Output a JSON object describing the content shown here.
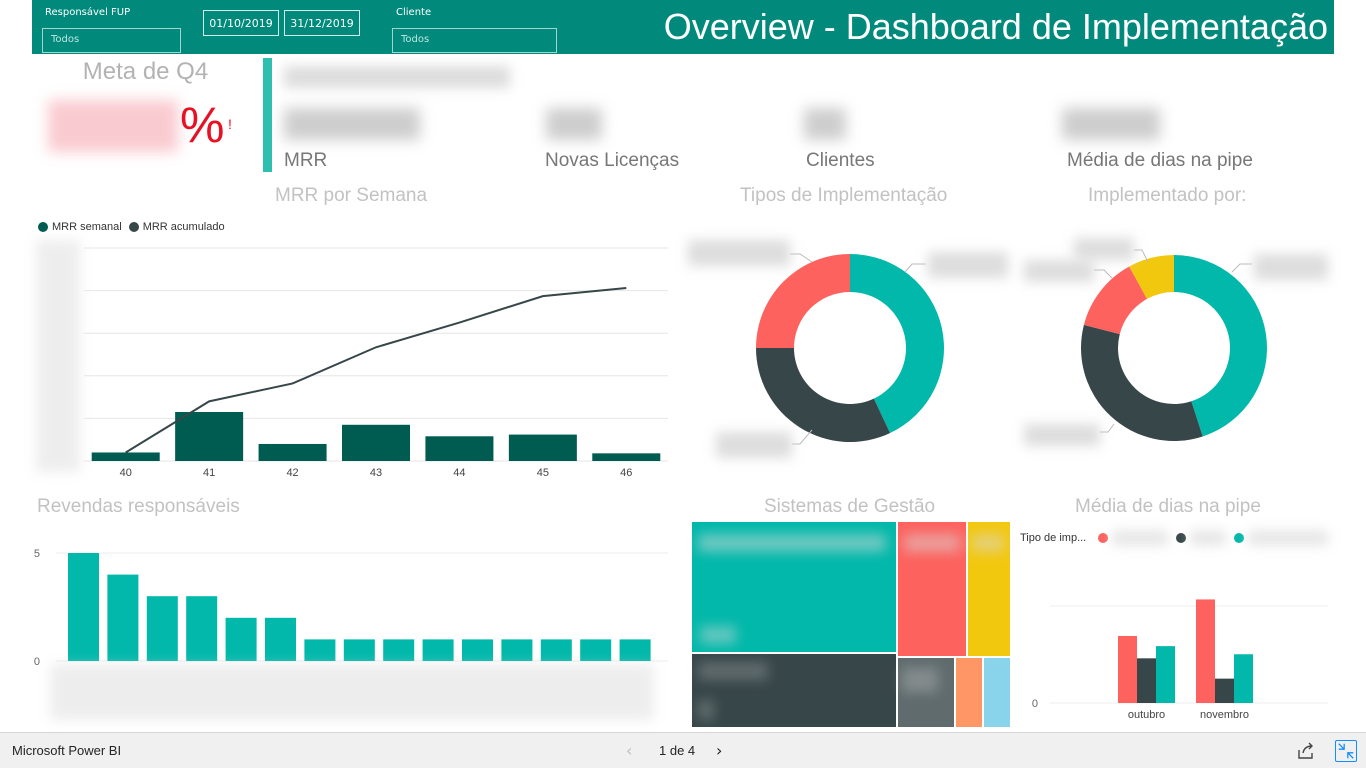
{
  "header": {
    "title": "Overview - Dashboard de Implementação",
    "filters": {
      "responsavel_label": "Responsável FUP",
      "responsavel_value": "Todos",
      "date_start": "01/10/2019",
      "date_end": "31/12/2019",
      "cliente_label": "Cliente",
      "cliente_value": "Todos"
    }
  },
  "kpis": {
    "meta_title": "Meta de Q4",
    "meta_symbol": "%",
    "meta_exclamation": "!",
    "labels": [
      "MRR",
      "Novas Licenças",
      "Clientes",
      "Média de dias na pipe"
    ]
  },
  "visual_titles": {
    "mrr_week": "MRR por Semana",
    "tipos": "Tipos de Implementação",
    "implementado": "Implementado por:",
    "revendas": "Revendas responsáveis",
    "sistemas": "Sistemas de Gestão",
    "media_dias": "Média de dias na pipe"
  },
  "colors": {
    "teal": "#01b8aa",
    "dark_gray": "#374649",
    "red": "#fd625e",
    "yellow": "#f2c80f",
    "gray": "#5f6b6d",
    "orange": "#fe9666",
    "light_blue": "#8ad4eb",
    "dark_teal": "#005b50",
    "header_bg": "#018a7c"
  },
  "chart_data": [
    {
      "type": "bar",
      "name": "mrr_week",
      "categories": [
        "40",
        "41",
        "42",
        "43",
        "44",
        "45",
        "46"
      ],
      "legend": [
        "MRR semanal",
        "MRR acumulado"
      ],
      "series": [
        {
          "name": "MRR semanal",
          "values": [
            2,
            11.5,
            4,
            8.5,
            5.8,
            6.2,
            1.8
          ]
        },
        {
          "name": "MRR acumulado",
          "values": [
            2,
            14,
            18.2,
            26.7,
            32.5,
            38.7,
            40.6
          ]
        }
      ],
      "ylim": [
        0,
        50
      ]
    },
    {
      "type": "pie",
      "name": "tipos",
      "slices": [
        {
          "color": "#01b8aa",
          "value": 43
        },
        {
          "color": "#374649",
          "value": 32
        },
        {
          "color": "#fd625e",
          "value": 25
        }
      ]
    },
    {
      "type": "pie",
      "name": "implementado",
      "slices": [
        {
          "color": "#01b8aa",
          "value": 45
        },
        {
          "color": "#374649",
          "value": 34
        },
        {
          "color": "#fd625e",
          "value": 13
        },
        {
          "color": "#f2c80f",
          "value": 8
        }
      ]
    },
    {
      "type": "bar",
      "name": "revendas",
      "values": [
        5,
        4,
        3,
        3,
        2,
        2,
        1,
        1,
        1,
        1,
        1,
        1,
        1,
        1,
        1
      ],
      "yticks": [
        "5",
        "0"
      ],
      "ylim": [
        0,
        5
      ]
    },
    {
      "type": "bar",
      "name": "media_dias",
      "legend_title": "Tipo de imp...",
      "categories": [
        "outubro",
        "novembro"
      ],
      "series": [
        {
          "color": "#fd625e",
          "values": [
            33,
            51
          ]
        },
        {
          "color": "#374649",
          "values": [
            22,
            12
          ]
        },
        {
          "color": "#01b8aa",
          "values": [
            28,
            24
          ]
        }
      ],
      "yticks": [
        "0"
      ],
      "ylim": [
        0,
        65
      ]
    }
  ],
  "footer": {
    "app_name": "Microsoft Power BI",
    "page_indicator": "1 de 4",
    "prev_icon": "‹",
    "next_icon": "›"
  }
}
